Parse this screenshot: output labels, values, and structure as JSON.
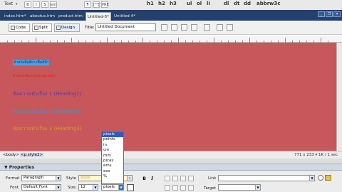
{
  "toolbar": {
    "insert_menu": "Text",
    "text_tools": [
      "B",
      "I",
      "S",
      "em",
      "¶",
      "[\"\"]",
      "PRE",
      "h1",
      "h2",
      "h3",
      "ul",
      "ol",
      "li",
      "dl",
      "dt",
      "dd",
      "abbr",
      "w3c"
    ]
  },
  "tabs": [
    {
      "label": "index.htm*"
    },
    {
      "label": "aboutus.htm"
    },
    {
      "label": "product.htm"
    },
    {
      "label": "Untitled-5*"
    },
    {
      "label": "Untitled-4*"
    }
  ],
  "doc_toolbar": {
    "code_label": "Code",
    "split_label": "Split",
    "design_label": "Design",
    "title_label": "Title:",
    "title_value": "Untitled Document"
  },
  "canvas": {
    "bg_color": "#c8575b",
    "lines": [
      {
        "text": "ตัวหนังสือสีขาวพื้นสีฟ้า"
      },
      {
        "text": "ตัวอักษรสีแดง(paragraph)"
      },
      {
        "text": "ข้อความหัวเรื่อง 1 (Heading1)"
      },
      {
        "text": "ข้อความหัวเรื่อง 2 (Heading2)"
      },
      {
        "text": "ข้อความหัวเรื่อง 3 (Heading3)"
      }
    ]
  },
  "unit_dropdown": {
    "options": [
      "pixels",
      "points",
      "in",
      "cm",
      "mm",
      "picas",
      "ems",
      "exs",
      "%"
    ],
    "selected": "pixels"
  },
  "status_bar": {
    "tag_body": "<body>",
    "tag_p": "<p.style2>",
    "dimensions": "771 x 233 ▾ 1K / 1 sec"
  },
  "properties": {
    "header": "▼ Properties",
    "format_label": "Format",
    "format_value": "Paragraph",
    "style_label": "Style",
    "style_value": "style",
    "font_label": "Font",
    "font_value": "Default Font",
    "size_label": "Size",
    "size_value": "12",
    "unit_value": "pixels",
    "link_label": "Link",
    "target_label": "Target"
  }
}
